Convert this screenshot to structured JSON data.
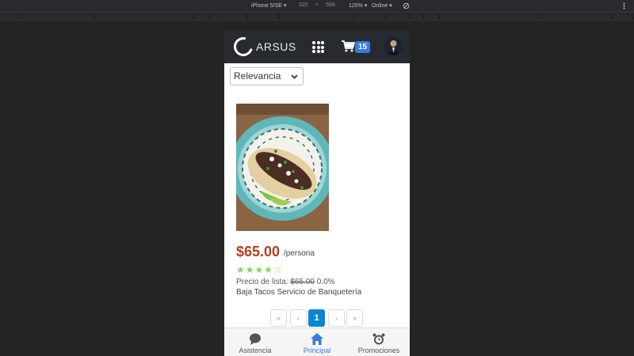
{
  "devtools": {
    "device": "iPhone 5/SE ▾",
    "width": "320",
    "times": "×",
    "height": "568",
    "zoom": "125% ▾",
    "network": "Online ▾"
  },
  "header": {
    "logo_text": "ARSUS",
    "cart_count": "15"
  },
  "sort": {
    "selected": "Relevancia"
  },
  "product": {
    "price": "$65.00",
    "unit": "/persona",
    "rating": 4,
    "rating_max": 5,
    "stars_text": "★★★★☆",
    "list_price_label": "Precio de lista:",
    "list_price": "$65.00",
    "discount": "0.0%",
    "vendor": "Baja Tacos Servicio de Banquetería"
  },
  "pagination": {
    "first": "«",
    "prev": "‹",
    "current": "1",
    "next": "›",
    "last": "»"
  },
  "tabs": [
    {
      "label": "Asistencia",
      "icon": "chat-icon"
    },
    {
      "label": "Principal",
      "icon": "home-icon"
    },
    {
      "label": "Promociones",
      "icon": "alarm-icon"
    }
  ],
  "colors": {
    "navbar": "#272b30",
    "accent": "#3a7ae0",
    "price": "#b0401e",
    "stars": "#7ed957",
    "pager_active": "#0a85d0"
  }
}
